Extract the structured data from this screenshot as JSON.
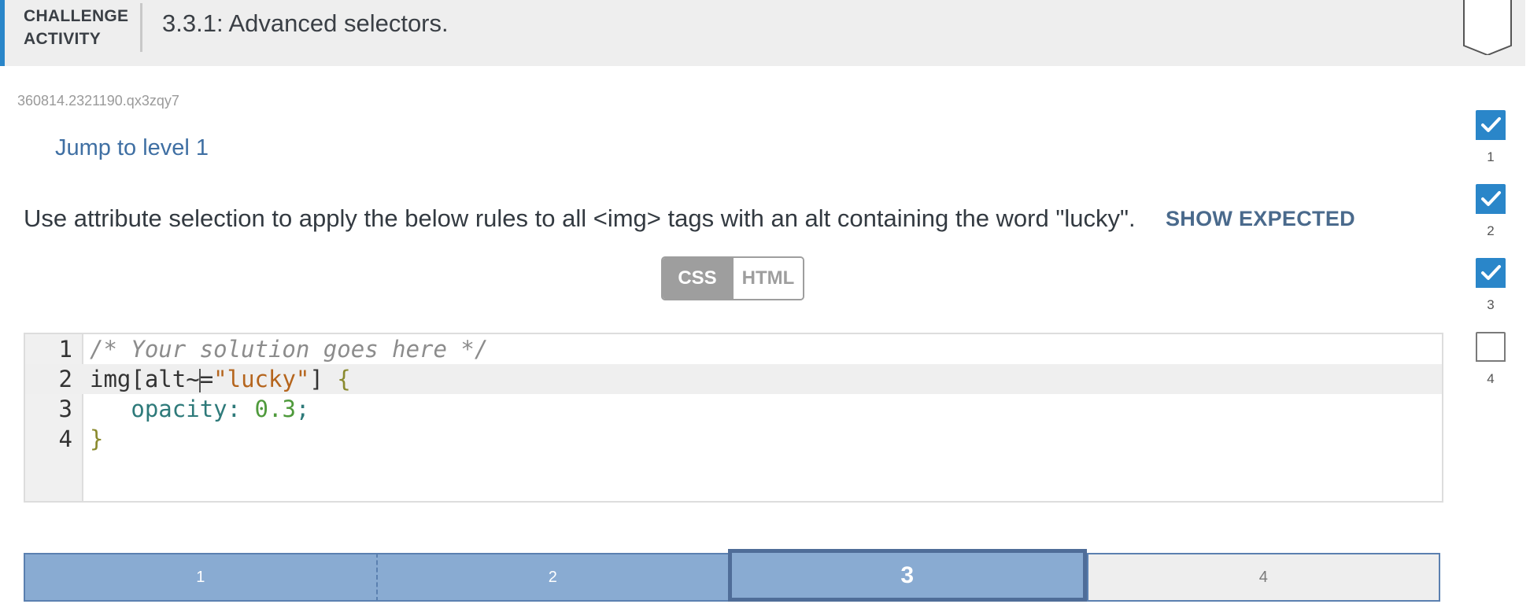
{
  "header": {
    "label": "CHALLENGE ACTIVITY",
    "title": "3.3.1: Advanced selectors."
  },
  "activity_id": "360814.2321190.qx3zqy7",
  "jump_link": "Jump to level 1",
  "instructions": "Use attribute selection to apply the below rules to all <img> tags with an alt containing the word \"lucky\".",
  "show_expected": "SHOW EXPECTED",
  "toggle": {
    "css": "CSS",
    "html": "HTML",
    "selected": "CSS"
  },
  "editor": {
    "line_numbers": [
      "1",
      "2",
      "3",
      "4"
    ],
    "line1": "/* Your solution goes here */",
    "line2": {
      "sel_before_cursor": "img[alt~",
      "sel_after_cursor": "=",
      "str": "\"lucky\"",
      "close": "]",
      "brace": " {"
    },
    "line3": {
      "indent": "   ",
      "prop": "opacity",
      "colon": ": ",
      "value": "0.3",
      "semi": ";"
    },
    "line4": "}"
  },
  "levels": [
    {
      "label": "1",
      "state": "completed"
    },
    {
      "label": "2",
      "state": "completed"
    },
    {
      "label": "3",
      "state": "current"
    },
    {
      "label": "4",
      "state": "incomplete"
    }
  ],
  "progress": [
    {
      "label": "1",
      "checked": true
    },
    {
      "label": "2",
      "checked": true
    },
    {
      "label": "3",
      "checked": true
    },
    {
      "label": "4",
      "checked": false
    }
  ],
  "colors": {
    "accent": "#2a86c9",
    "level_fill": "#89abd2",
    "link": "#3f6fa3"
  }
}
